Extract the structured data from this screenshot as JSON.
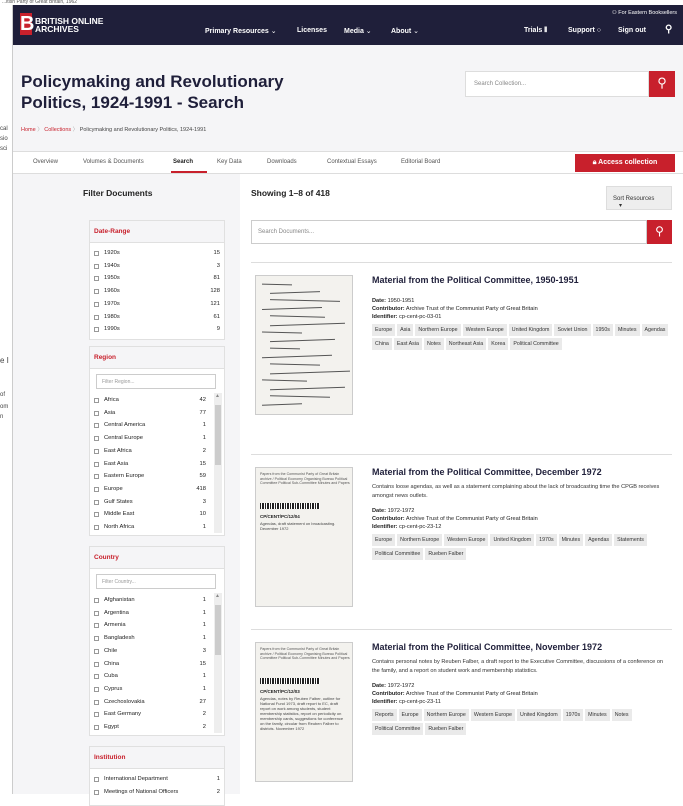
{
  "top_strip": "...itish Party of Great Britain, 1962",
  "left_strip": [
    "cal",
    "sio",
    "sci",
    "e I",
    "of",
    "om",
    "n"
  ],
  "nav": {
    "logo_letter": "B",
    "logo_text": "BRITISH ONLINE ARCHIVES",
    "links": [
      "Primary Resources",
      "Licenses",
      "Media",
      "About"
    ],
    "right_links": [
      "Trials",
      "Support",
      "Sign out"
    ],
    "access_for": "For Eastern Booksellers",
    "chevron": "⌄",
    "search_icon": "search-icon"
  },
  "title": "Policymaking and Revolutionary Politics, 1924-1991 - Search",
  "search_collection_placeholder": "Search Collection...",
  "breadcrumb": [
    "Home",
    "Collections",
    "Policymaking and Revolutionary Politics, 1924-1991"
  ],
  "tabs": [
    "Overview",
    "Volumes & Documents",
    "Search",
    "Key Data",
    "Downloads",
    "Contextual Essays",
    "Editorial Board"
  ],
  "access_collection": "Access collection",
  "filter_title": "Filter Documents",
  "filters": {
    "date_range": {
      "title": "Date-Range",
      "items": [
        [
          "1920s",
          "15"
        ],
        [
          "1940s",
          "3"
        ],
        [
          "1950s",
          "81"
        ],
        [
          "1960s",
          "128"
        ],
        [
          "1970s",
          "121"
        ],
        [
          "1980s",
          "61"
        ],
        [
          "1990s",
          "9"
        ]
      ]
    },
    "region": {
      "title": "Region",
      "placeholder": "Filter Region...",
      "items": [
        [
          "Africa",
          "42"
        ],
        [
          "Asia",
          "77"
        ],
        [
          "Central America",
          "1"
        ],
        [
          "Central Europe",
          "1"
        ],
        [
          "East Africa",
          "2"
        ],
        [
          "East Asia",
          "15"
        ],
        [
          "Eastern Europe",
          "59"
        ],
        [
          "Europe",
          "418"
        ],
        [
          "Gulf States",
          "3"
        ],
        [
          "Middle East",
          "10"
        ],
        [
          "North Africa",
          "1"
        ]
      ]
    },
    "country": {
      "title": "Country",
      "placeholder": "Filter Country...",
      "items": [
        [
          "Afghanistan",
          "1"
        ],
        [
          "Argentina",
          "1"
        ],
        [
          "Armenia",
          "1"
        ],
        [
          "Bangladesh",
          "1"
        ],
        [
          "Chile",
          "3"
        ],
        [
          "China",
          "15"
        ],
        [
          "Cuba",
          "1"
        ],
        [
          "Cyprus",
          "1"
        ],
        [
          "Czechoslovakia",
          "27"
        ],
        [
          "East Germany",
          "2"
        ],
        [
          "Egypt",
          "2"
        ]
      ]
    },
    "institution": {
      "title": "Institution",
      "items": [
        [
          "International Department",
          "1"
        ],
        [
          "Meetings of National Officers",
          "2"
        ]
      ]
    }
  },
  "showing": "Showing 1–8 of 418",
  "sort_label": "Sort Resources",
  "doc_search_placeholder": "Search Documents...",
  "results": [
    {
      "title": "Material from the Political Committee, 1950-1951",
      "description": "",
      "date_label": "Date:",
      "date": "1950-1951",
      "contributor_label": "Contributor:",
      "contributor": "Archive Trust of the Communist Party of Great Britain",
      "identifier_label": "Identifier:",
      "identifier": "cp-cent-pc-03-01",
      "tags": [
        "Europe",
        "Asia",
        "Northern Europe",
        "Western Europe",
        "United Kingdom",
        "Soviet Union",
        "1950s",
        "Minutes",
        "Agendas",
        "China",
        "East Asia",
        "Notes",
        "Northeast Asia",
        "Korea",
        "Political Committee"
      ]
    },
    {
      "title": "Material from the Political Committee, December 1972",
      "description": "Contains loose agendas, as well as a statement complaining about the lack of broadcasting time the CPGB receives amongst news outlets.",
      "date_label": "Date:",
      "date": "1972-1972",
      "contributor_label": "Contributor:",
      "contributor": "Archive Trust of the Communist Party of Great Britain",
      "identifier_label": "Identifier:",
      "identifier": "cp-cent-pc-23-12",
      "tags": [
        "Europe",
        "Northern Europe",
        "Western Europe",
        "United Kingdom",
        "1970s",
        "Minutes",
        "Agendas",
        "Statements",
        "Political Committee",
        "Rueben Falber"
      ],
      "thumb": {
        "label": "Papers from the Communist Party of Great Britain archive / Political Economy Organising Bureau Political Committee Political Sub-Committee Minutes and Papers",
        "id": "CP/CENT/PC/12/04",
        "sub": "Agendas, draft statement on broadcasting. December 1972"
      }
    },
    {
      "title": "Material from the Political Committee, November 1972",
      "description": "Contains personal notes by Reuben Falber, a draft report to the Executive Committee, discussions of a conference on the family, and a report on student work and membership statistics.",
      "date_label": "Date:",
      "date": "1972-1972",
      "contributor_label": "Contributor:",
      "contributor": "Archive Trust of the Communist Party of Great Britain",
      "identifier_label": "Identifier:",
      "identifier": "cp-cent-pc-23-11",
      "tags": [
        "Reports",
        "Europe",
        "Northern Europe",
        "Western Europe",
        "United Kingdom",
        "1970s",
        "Minutes",
        "Notes",
        "Political Committee",
        "Rueben Falber"
      ],
      "thumb": {
        "label": "Papers from the Communist Party of Great Britain archive / Political Economy Organising Bureau Political Committee Political Sub-Committee Minutes and Papers",
        "id": "CP/CENT/PC/12/03",
        "sub": "Agendas, notes by Reuben Falber, outline for National Fund 1973, draft report to EC, draft report on work among students, student membership statistics, report on periodicity on membership cards, suggestions for conference on the family, circular from Reuben Falber to districts. November 1972"
      }
    }
  ],
  "colors": {
    "accent": "#c8202c",
    "nav": "#1f1f3a"
  }
}
